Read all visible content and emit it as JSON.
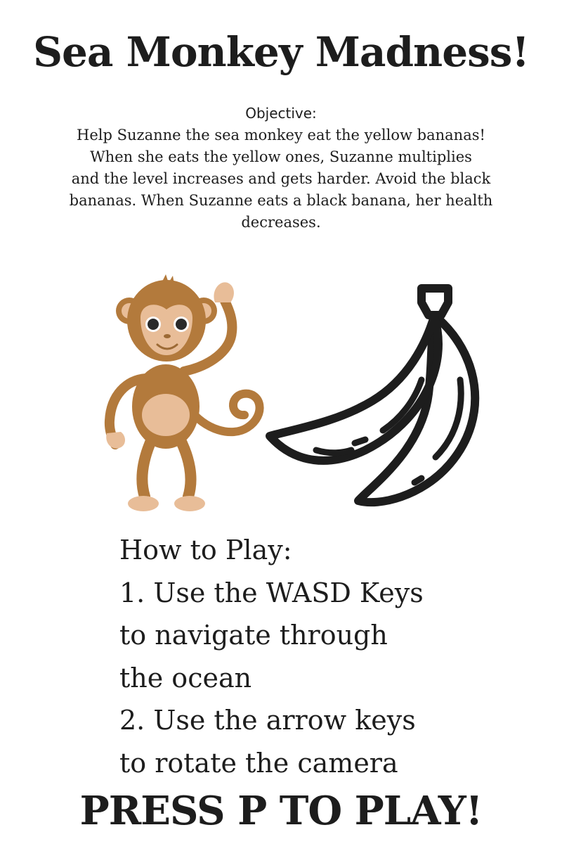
{
  "title": "Sea Monkey Madness!",
  "objective": {
    "heading": "Objective:",
    "lines": [
      "Help Suzanne the sea monkey eat the yellow bananas!",
      "When she eats the yellow ones, Suzanne multiplies",
      "and the level increases and gets harder. Avoid the black",
      "bananas. When Suzanne eats a black banana, her health",
      "decreases."
    ]
  },
  "illustration": {
    "monkey_icon": "monkey-icon",
    "banana_icon": "banana-bunch-icon",
    "colors": {
      "monkey_fur": "#b37a3c",
      "monkey_face": "#e8bd98",
      "banana_outline": "#1d1d1d"
    }
  },
  "how_to_play": {
    "heading": "How to Play:",
    "lines": [
      "1. Use the WASD Keys",
      "to navigate through",
      "the ocean",
      "2. Use the arrow keys",
      "to rotate the camera"
    ]
  },
  "start_prompt": "PRESS P TO PLAY!"
}
